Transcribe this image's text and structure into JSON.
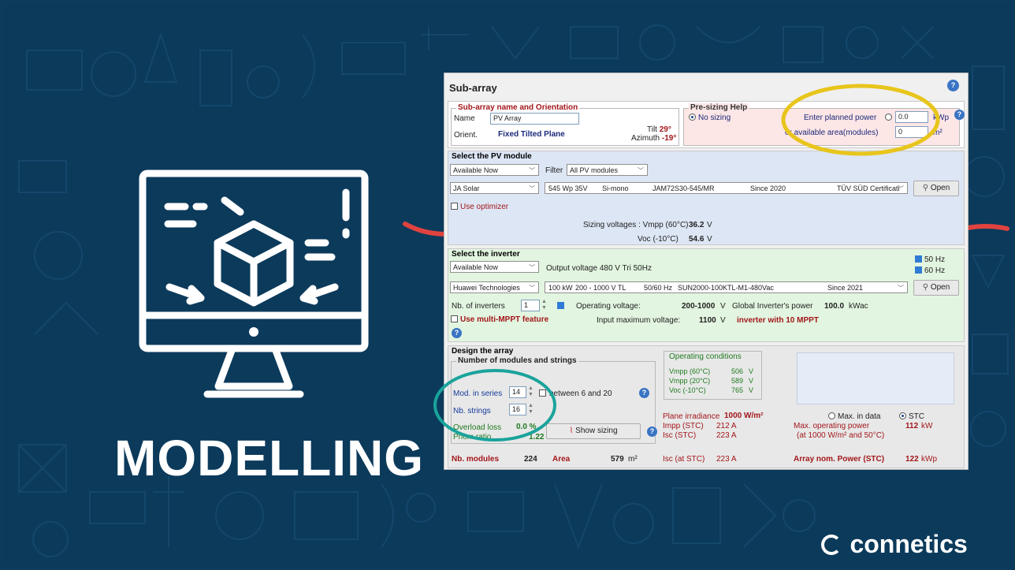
{
  "slide": {
    "heading": "MODELLING",
    "brand": "connetics"
  },
  "window": {
    "title": "Sub-array"
  },
  "subarray": {
    "section_title": "Sub-array name and Orientation",
    "name_label": "Name",
    "name_value": "PV Array",
    "orient_label": "Orient.",
    "orient_value": "Fixed Tilted Plane",
    "tilt_label": "Tilt",
    "tilt_value": "29°",
    "azimuth_label": "Azimuth",
    "azimuth_value": "-19°"
  },
  "presizing": {
    "title": "Pre-sizing Help",
    "no_sizing_label": "No sizing",
    "planned_power_label": "Enter planned power",
    "planned_power_value": "0.0",
    "planned_power_unit": "kWp",
    "area_label": "or available area(modules)",
    "area_value": "0",
    "area_unit": "m²"
  },
  "pv_module": {
    "title": "Select the PV module",
    "availability": "Available Now",
    "filter_label": "Filter",
    "filter_value": "All PV modules",
    "manufacturer": "JA Solar",
    "module_power": "545 Wp 35V",
    "module_tech": "Si-mono",
    "module_model": "JAM72S30-545/MR",
    "module_since": "Since 2020",
    "module_cert": "TÜV SÜD Certificati",
    "open_label": "Open",
    "use_optimizer_label": "Use optimizer",
    "sizing_voltages_label": "Sizing voltages : Vmpp (60°C)",
    "vmpp_value": "36.2",
    "vmpp_unit": "V",
    "voc_label": "Voc (-10°C)",
    "voc_value": "54.6",
    "voc_unit": "V"
  },
  "inverter": {
    "title": "Select the inverter",
    "availability": "Available Now",
    "output_voltage": "Output voltage 480 V Tri 50Hz",
    "hz50_label": "50 Hz",
    "hz60_label": "60 Hz",
    "manufacturer": "Huawei Technologies",
    "inv_power": "100 kW",
    "inv_range": "200 - 1000 V TL",
    "inv_freq": "50/60 Hz",
    "inv_model": "SUN2000-100KTL-M1-480Vac",
    "inv_since": "Since 2021",
    "open_label": "Open",
    "nb_inverters_label": "Nb. of inverters",
    "nb_inverters_value": "1",
    "operating_voltage_label": "Operating voltage:",
    "operating_voltage_value": "200-1000",
    "operating_voltage_unit": "V",
    "global_power_label": "Global Inverter's power",
    "global_power_value": "100.0",
    "global_power_unit": "kWac",
    "multi_mppt_label": "Use multi-MPPT feature",
    "input_max_label": "Input maximum voltage:",
    "input_max_value": "1100",
    "input_max_unit": "V",
    "mppt_note": "inverter with 10 MPPT"
  },
  "design": {
    "title": "Design the array",
    "group_title": "Number of modules and strings",
    "mod_series_label": "Mod. in series",
    "mod_series_value": "14",
    "between_label": "between 6 and 20",
    "nb_strings_label": "Nb. strings",
    "nb_strings_value": "16",
    "overload_label": "Overload loss",
    "overload_value": "0.0 %",
    "pnom_label": "Pnom ratio",
    "pnom_value": "1.22",
    "show_sizing_label": "Show sizing",
    "nb_modules_label": "Nb. modules",
    "nb_modules_value": "224",
    "area_label": "Area",
    "area_value": "579",
    "area_unit": "m²",
    "op_cond_title": "Operating conditions",
    "vmpp60_label": "Vmpp (60°C)",
    "vmpp60_value": "506",
    "vmpp60_unit": "V",
    "vmpp20_label": "Vmpp (20°C)",
    "vmpp20_value": "589",
    "vmpp20_unit": "V",
    "voc10_label": "Voc (-10°C)",
    "voc10_value": "765",
    "voc10_unit": "V",
    "plane_irr_label": "Plane irradiance",
    "plane_irr_value": "1000 W/m²",
    "max_data_label": "Max. in data",
    "stc_label": "STC",
    "impp_label": "Impp (STC)",
    "impp_value": "212 A",
    "isc_label": "Isc (STC)",
    "isc_value": "223 A",
    "max_op_label": "Max. operating power",
    "max_op_value": "112",
    "max_op_unit": "kW",
    "max_op_note": "(at 1000 W/m² and 50°C)",
    "isc_at_label": "Isc (at STC)",
    "isc_at_value": "223 A",
    "array_nom_label": "Array nom. Power (STC)",
    "array_nom_value": "122",
    "array_nom_unit": "kWp"
  },
  "colors": {
    "background": "#0b3a5b",
    "annotation_yellow": "#e8c51c",
    "annotation_teal": "#1aa39b",
    "annotation_red": "#e0433f"
  }
}
